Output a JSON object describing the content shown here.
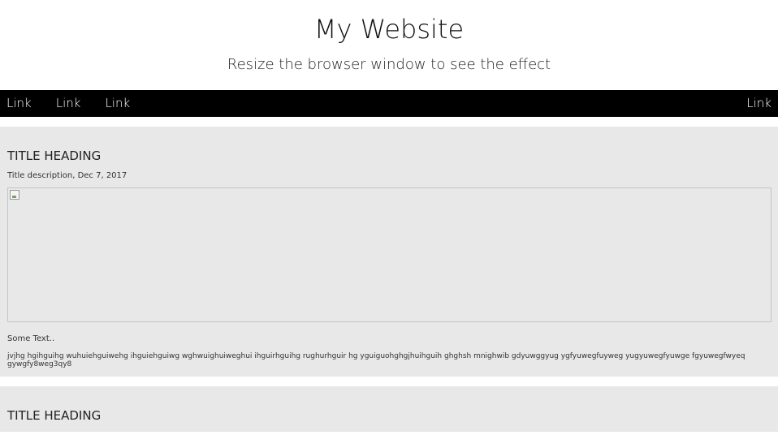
{
  "header": {
    "title": "My Website",
    "subtitle": "Resize the browser window to see the effect"
  },
  "nav": {
    "left_links": [
      "Link",
      "Link",
      "Link"
    ],
    "right_link": "Link"
  },
  "posts": [
    {
      "heading": "TITLE HEADING",
      "description": "Title description, Dec 7, 2017",
      "some_text": "Some Text..",
      "body": "jvjhg hgihguihg wuhuiehguiwehg ihguiehguiwg wghwuighuiweghui ihguirhguihg rughurhguir hg yguiguohghgjhuihguih ghghsh mnighwib gdyuwggyug ygfyuwegfuyweg yugyuwegfyuwge fgyuwegfwyeq gywgfy8weg3qy8"
    },
    {
      "heading": "TITLE HEADING"
    }
  ]
}
